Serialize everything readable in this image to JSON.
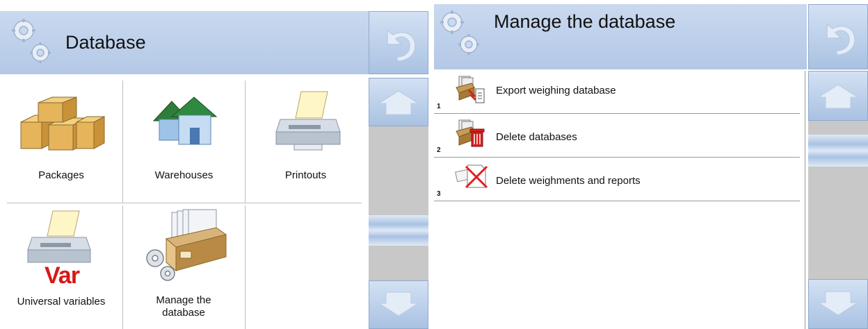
{
  "left_panel": {
    "title": "Database",
    "back_icon": "undo-arrow-icon",
    "scroll_up_icon": "arrow-up-icon",
    "scroll_down_icon": "arrow-down-icon",
    "items": [
      {
        "label": "Packages",
        "icon": "packages-icon"
      },
      {
        "label": "Warehouses",
        "icon": "warehouses-icon"
      },
      {
        "label": "Printouts",
        "icon": "printer-icon"
      },
      {
        "label": "Universal variables",
        "icon": "printer-var-icon",
        "icon_text": "Var"
      },
      {
        "label": "Manage the database",
        "icon": "database-drawer-icon"
      }
    ]
  },
  "right_panel": {
    "title": "Manage the database",
    "back_icon": "undo-arrow-icon",
    "scroll_up_icon": "arrow-up-icon",
    "scroll_down_icon": "arrow-down-icon",
    "items": [
      {
        "number": "1",
        "label": "Export weighing database",
        "icon": "export-database-icon"
      },
      {
        "number": "2",
        "label": "Delete databases",
        "icon": "delete-databases-icon"
      },
      {
        "number": "3",
        "label": "Delete weighments and reports",
        "icon": "delete-reports-icon"
      }
    ]
  }
}
